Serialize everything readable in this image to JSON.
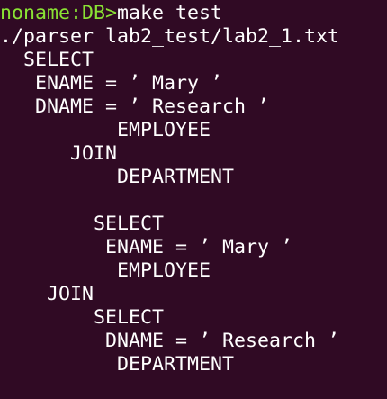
{
  "terminal": {
    "prompt": "noname:DB>",
    "command": "make test",
    "lines": [
      "./parser lab2_test/lab2_1.txt",
      "  SELECT",
      "   ENAME = ’ Mary ’",
      "   DNAME = ’ Research ’",
      "          EMPLOYEE",
      "      JOIN",
      "          DEPARTMENT",
      "",
      "        SELECT",
      "         ENAME = ’ Mary ’",
      "          EMPLOYEE",
      "    JOIN",
      "        SELECT",
      "         DNAME = ’ Research ’",
      "          DEPARTMENT"
    ]
  },
  "colors": {
    "background": "#300a24",
    "prompt": "#8ae234",
    "text": "#ffffff"
  }
}
